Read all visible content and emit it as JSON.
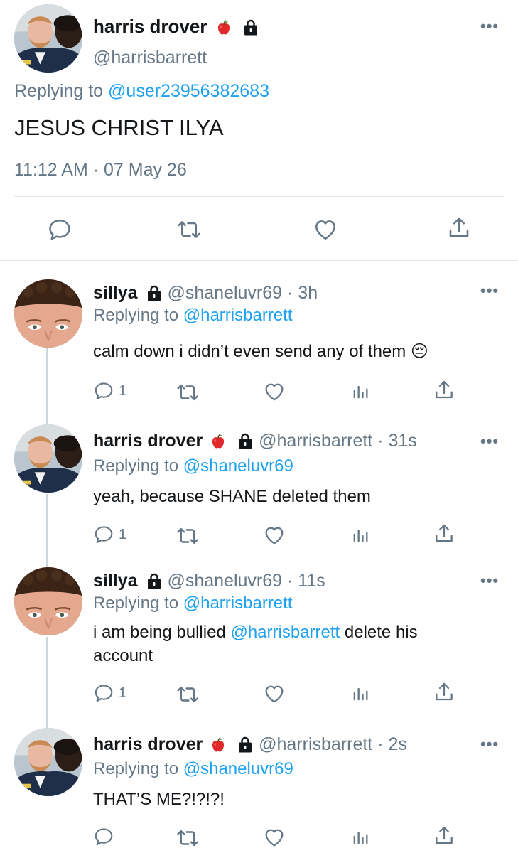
{
  "main_tweet": {
    "display_name": "harris drover",
    "handle": "@harrisbarrett",
    "replying_prefix": "Replying to",
    "replying_to": "@user23956382683",
    "text": "JESUS CHRIST ILYA",
    "timestamp": "11:12 AM · 07 May 26",
    "more": "•••"
  },
  "replies": [
    {
      "display_name": "sillya",
      "handle": "@shaneluvr69",
      "time": "· 3h",
      "replying_prefix": "Replying to",
      "replying_to": "@harrisbarrett",
      "text": "calm down i didn’t even send any of them",
      "emoji": "😔",
      "reply_count": "1",
      "more": "•••"
    },
    {
      "display_name": "harris drover",
      "handle": "@harrisbarrett",
      "time": "· 31s",
      "replying_prefix": "Replying to",
      "replying_to": "@shaneluvr69",
      "text": "yeah, because SHANE deleted them",
      "reply_count": "1",
      "more": "•••"
    },
    {
      "display_name": "sillya",
      "handle": "@shaneluvr69",
      "time": "· 11s",
      "replying_prefix": "Replying to",
      "replying_to": "@harrisbarrett",
      "text_before": "i am being bullied",
      "mention": "@harrisbarrett",
      "text_after": "delete his",
      "text_line2": "account",
      "reply_count": "1",
      "more": "•••"
    },
    {
      "display_name": "harris drover",
      "handle": "@harrisbarrett",
      "time": "· 2s",
      "replying_prefix": "Replying to",
      "replying_to": "@shaneluvr69",
      "text": "THAT’S ME?!?!?!",
      "reply_count": "",
      "more": "•••"
    }
  ],
  "colors": {
    "link_blue": "#1da1f2",
    "secondary_grey": "#657786",
    "divider": "#e1e8ed",
    "thread_line": "#ccd6dd"
  },
  "icons": [
    "apple-icon",
    "lock-icon",
    "reply-icon",
    "retweet-icon",
    "like-icon",
    "share-icon",
    "analytics-icon",
    "more-icon"
  ]
}
